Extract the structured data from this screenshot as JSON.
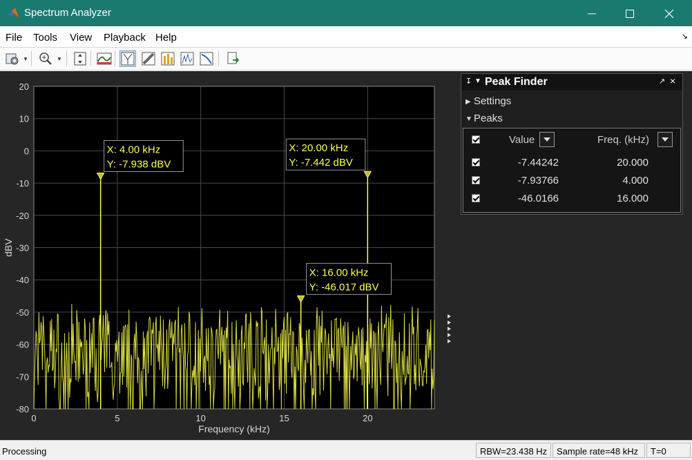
{
  "window": {
    "title": "Spectrum Analyzer"
  },
  "menu": [
    "File",
    "Tools",
    "View",
    "Playback",
    "Help"
  ],
  "toolbar": {
    "buttons": [
      "settings-icon",
      "zoom-in-icon",
      "autoscale-icon",
      "spectrum-settings-icon",
      "data-cursors-icon",
      "measurements-icon",
      "distortion-icon",
      "peak-finder-icon",
      "ccdf-icon",
      "print-icon"
    ]
  },
  "chart_data": {
    "type": "line",
    "xlabel": "Frequency (kHz)",
    "ylabel": "dBV",
    "xlim": [
      0,
      24
    ],
    "ylim": [
      -80,
      20
    ],
    "xticks": [
      0,
      5,
      10,
      15,
      20
    ],
    "yticks": [
      20,
      10,
      0,
      -10,
      -20,
      -30,
      -40,
      -50,
      -60,
      -70,
      -80
    ],
    "grid": true,
    "line_color": "#ffff4d",
    "noise_floor_dbv": [
      -75,
      -50
    ],
    "peaks": [
      {
        "x": 4.0,
        "y": -7.938,
        "label_x": "X: 4.00 kHz",
        "label_y": "Y: -7.938 dBV"
      },
      {
        "x": 20.0,
        "y": -7.442,
        "label_x": "X: 20.00 kHz",
        "label_y": "Y: -7.442 dBV"
      },
      {
        "x": 16.0,
        "y": -46.017,
        "label_x": "X: 16.00 kHz",
        "label_y": "Y: -46.017 dBV"
      }
    ]
  },
  "peak_finder": {
    "title": "Peak Finder",
    "settings_label": "Settings",
    "peaks_label": "Peaks",
    "col_value": "Value",
    "col_freq": "Freq. (kHz)",
    "rows": [
      {
        "value": "-7.44242",
        "freq": "20.000"
      },
      {
        "value": "-7.93766",
        "freq": "4.000"
      },
      {
        "value": "-46.0166",
        "freq": "16.000"
      }
    ]
  },
  "status": {
    "state": "Processing",
    "rbw": "RBW=23.438 Hz",
    "sample_rate": "Sample rate=48 kHz",
    "time": "T=0"
  }
}
